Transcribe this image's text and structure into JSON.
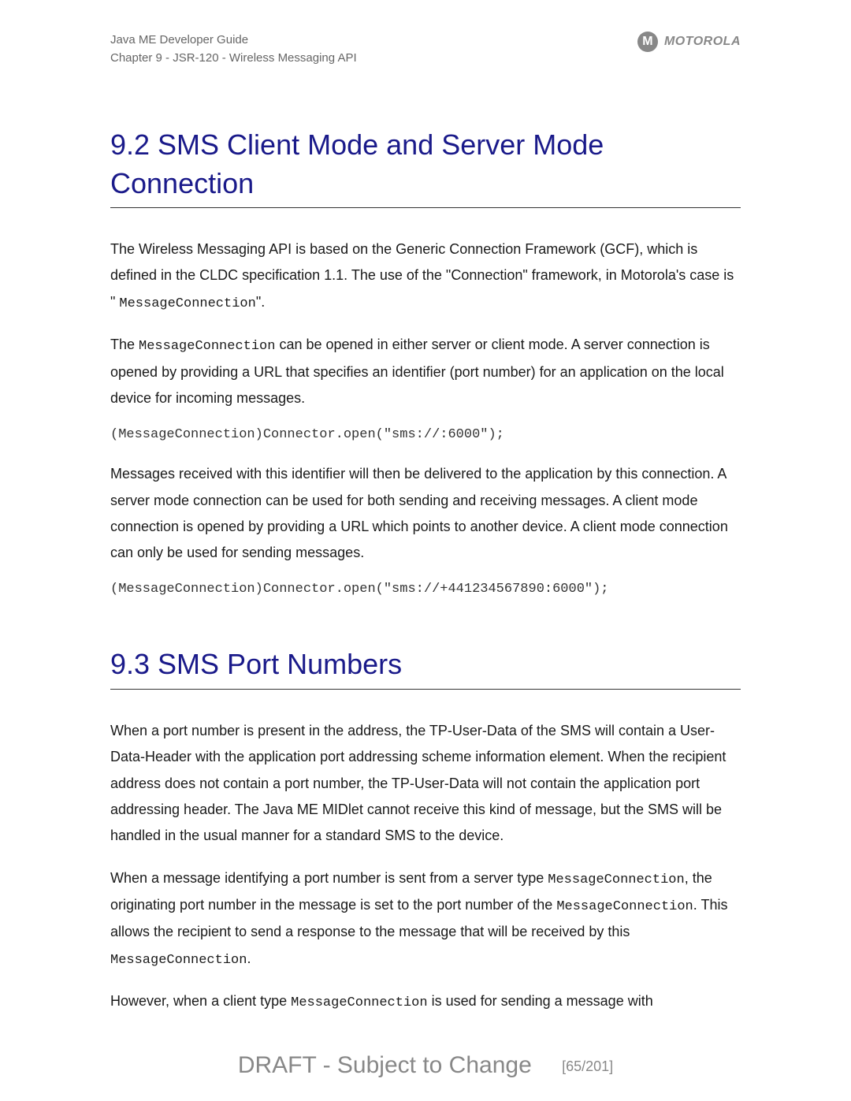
{
  "header": {
    "line1": "Java ME Developer Guide",
    "line2": "Chapter 9 - JSR-120 - Wireless Messaging API",
    "brand": "MOTOROLA",
    "logo_letter": "M"
  },
  "sections": {
    "s1": {
      "heading": "9.2 SMS Client Mode and Server Mode Connection",
      "p1_a": "The Wireless Messaging API is based on the Generic Connection Framework (GCF), which is defined in the CLDC specification 1.1. The use of the \"Connection\" framework, in Motorola's case is \" ",
      "p1_code": "MessageConnection",
      "p1_b": "\".",
      "p2_a": "The ",
      "p2_code": "MessageConnection",
      "p2_b": " can be opened in either server or client mode. A server connection is opened by providing a URL that specifies an identifier (port number) for an application on the local device for incoming messages.",
      "code1": "(MessageConnection)Connector.open(\"sms://:6000\");",
      "p3": "Messages received with this identifier will then be delivered to the application by this connection. A server mode connection can be used for both sending and receiving messages. A client mode connection is opened by providing a URL which points to another device. A client mode connection can only be used for sending messages.",
      "code2": "(MessageConnection)Connector.open(\"sms://+441234567890:6000\");"
    },
    "s2": {
      "heading": "9.3 SMS Port Numbers",
      "p1": "When a port number is present in the address, the TP-User-Data of the SMS will contain a User-Data-Header with the application port addressing scheme information element. When the recipient address does not contain a port number, the TP-User-Data will not contain the application port addressing header. The Java ME MIDlet cannot receive this kind of message, but the SMS will be handled in the usual manner for a standard SMS to the device.",
      "p2_a": "When a message identifying a port number is sent from a server type ",
      "p2_code1": "MessageConnection",
      "p2_b": ", the originating port number in the message is set to the port number of the ",
      "p2_code2": "MessageConnection",
      "p2_c": ". This allows the recipient to send a response to the message that will be received by this ",
      "p2_code3": "MessageConnection",
      "p2_d": ".",
      "p3_a": "However, when a client type ",
      "p3_code": "MessageConnection",
      "p3_b": " is used for sending a message with"
    }
  },
  "footer": {
    "draft": "DRAFT - Subject to Change",
    "page": "[65/201]"
  }
}
